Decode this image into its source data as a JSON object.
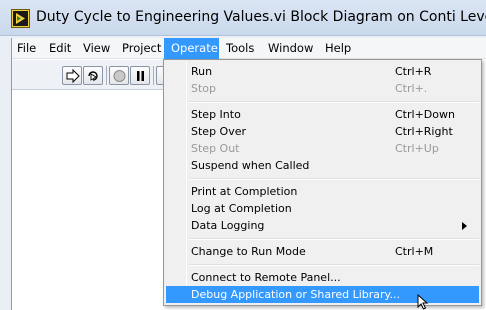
{
  "window": {
    "title": "Duty Cycle to Engineering Values.vi Block Diagram on Conti Level Ser"
  },
  "menubar": {
    "items": [
      {
        "label": "File"
      },
      {
        "label": "Edit"
      },
      {
        "label": "View"
      },
      {
        "label": "Project"
      },
      {
        "label": "Operate",
        "active": true
      },
      {
        "label": "Tools"
      },
      {
        "label": "Window"
      },
      {
        "label": "Help"
      }
    ]
  },
  "toolbar": {
    "buttons": [
      "run-arrow-icon",
      "run-continuously-icon",
      "abort-icon",
      "pause-icon",
      "highlight-execution-icon"
    ]
  },
  "operate_menu": {
    "items": [
      {
        "label": "Run",
        "shortcut": "Ctrl+R",
        "enabled": true
      },
      {
        "label": "Stop",
        "shortcut": "Ctrl+.",
        "enabled": false
      },
      {
        "label": "Step Into",
        "shortcut": "Ctrl+Down",
        "enabled": true
      },
      {
        "label": "Step Over",
        "shortcut": "Ctrl+Right",
        "enabled": true
      },
      {
        "label": "Step Out",
        "shortcut": "Ctrl+Up",
        "enabled": false
      },
      {
        "label": "Suspend when Called",
        "shortcut": "",
        "enabled": true
      },
      {
        "label": "Print at Completion",
        "shortcut": "",
        "enabled": true
      },
      {
        "label": "Log at Completion",
        "shortcut": "",
        "enabled": true
      },
      {
        "label": "Data Logging",
        "shortcut": "",
        "enabled": true,
        "submenu": true
      },
      {
        "label": "Change to Run Mode",
        "shortcut": "Ctrl+M",
        "enabled": true
      },
      {
        "label": "Connect to Remote Panel...",
        "shortcut": "",
        "enabled": true
      },
      {
        "label": "Debug Application or Shared Library...",
        "shortcut": "",
        "enabled": true,
        "highlighted": true
      }
    ]
  },
  "colors": {
    "highlight": "#3399ff",
    "menu_background": "#f0f0f0",
    "disabled_text": "#9a9a9a"
  }
}
